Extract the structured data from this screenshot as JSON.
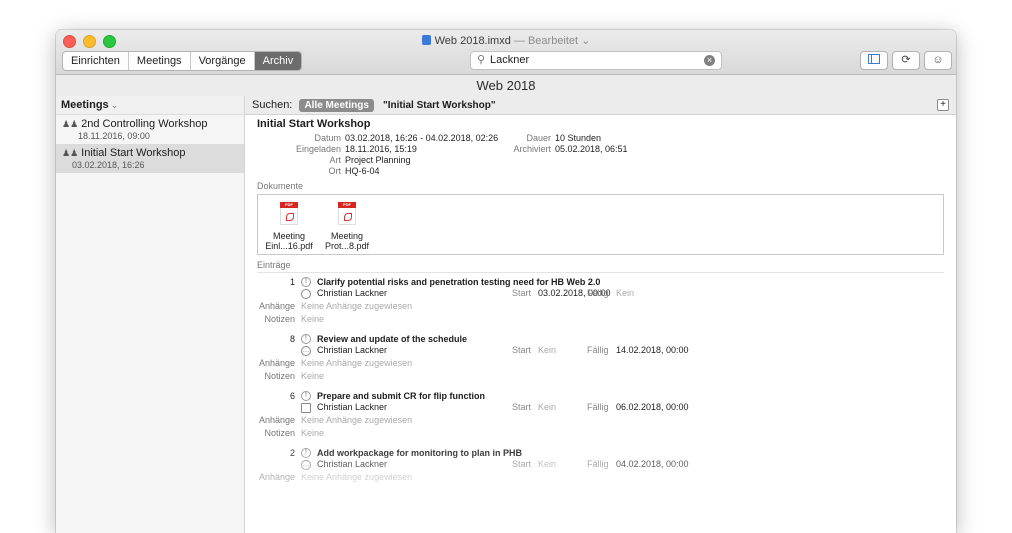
{
  "window": {
    "title": "Web 2018.imxd",
    "edited": "— Bearbeitet ⌄"
  },
  "toolbar": {
    "tabs": [
      {
        "label": "Einrichten"
      },
      {
        "label": "Meetings"
      },
      {
        "label": "Vorgänge"
      },
      {
        "label": "Archiv",
        "active": true
      }
    ],
    "search_value": "Lackner",
    "icons": [
      "sidebar-toggle-icon",
      "sync-icon",
      "smiley-icon"
    ]
  },
  "header": {
    "title": "Web 2018"
  },
  "sidebar": {
    "heading": "Meetings",
    "items": [
      {
        "title": "2nd Controlling Workshop",
        "date": "18.11.2016, 09:00"
      },
      {
        "title": "Initial Start Workshop",
        "date": "03.02.2018, 16:26",
        "selected": true
      }
    ]
  },
  "filter": {
    "label": "Suchen:",
    "pill": "Alle Meetings",
    "query": "\"Initial Start Workshop\""
  },
  "meeting": {
    "title": "Initial Start Workshop",
    "datum_label": "Datum",
    "datum": "03.02.2018, 16:26 - 04.02.2018, 02:26",
    "dauer_label": "Dauer",
    "dauer": "10 Stunden",
    "eingeladen_label": "Eingeladen",
    "eingeladen": "18.11.2016, 15:19",
    "archiviert_label": "Archiviert",
    "archiviert": "05.02.2018, 06:51",
    "art_label": "Art",
    "art": "Project Planning",
    "ort_label": "Ort",
    "ort": "HQ-6-04"
  },
  "documents": {
    "label": "Dokumente",
    "items": [
      {
        "line1": "Meeting",
        "line2": "Einl...16.pdf"
      },
      {
        "line1": "Meeting",
        "line2": "Prot...8.pdf"
      }
    ]
  },
  "entries": {
    "label": "Einträge",
    "start_label": "Start",
    "due_label": "Fällig",
    "attach_label": "Anhänge",
    "notes_label": "Notizen",
    "items": [
      {
        "num": "1",
        "title": "Clarify potential risks and penetration testing need for HB Web 2.0",
        "person": "Christian Lackner",
        "start": "03.02.2018, 00:00",
        "due": "Kein",
        "attachments": "Keine Anhänge zugewiesen",
        "notes": "Keine"
      },
      {
        "num": "8",
        "title": "Review and update of the schedule",
        "person": "Christian Lackner",
        "start": "Kein",
        "due": "14.02.2018, 00:00",
        "attachments": "Keine Anhänge zugewiesen",
        "notes": "Keine"
      },
      {
        "num": "6",
        "title": "Prepare and submit CR for flip function",
        "person": "Christian Lackner",
        "start": "Kein",
        "due": "06.02.2018, 00:00",
        "attachments": "Keine Anhänge zugewiesen",
        "notes": "Keine"
      },
      {
        "num": "2",
        "title": "Add workpackage for monitoring to plan in PHB",
        "person": "Christian Lackner",
        "start": "Kein",
        "due": "04.02.2018, 00:00",
        "attachments": "Keine Anhänge zugewiesen",
        "notes": ""
      }
    ]
  }
}
